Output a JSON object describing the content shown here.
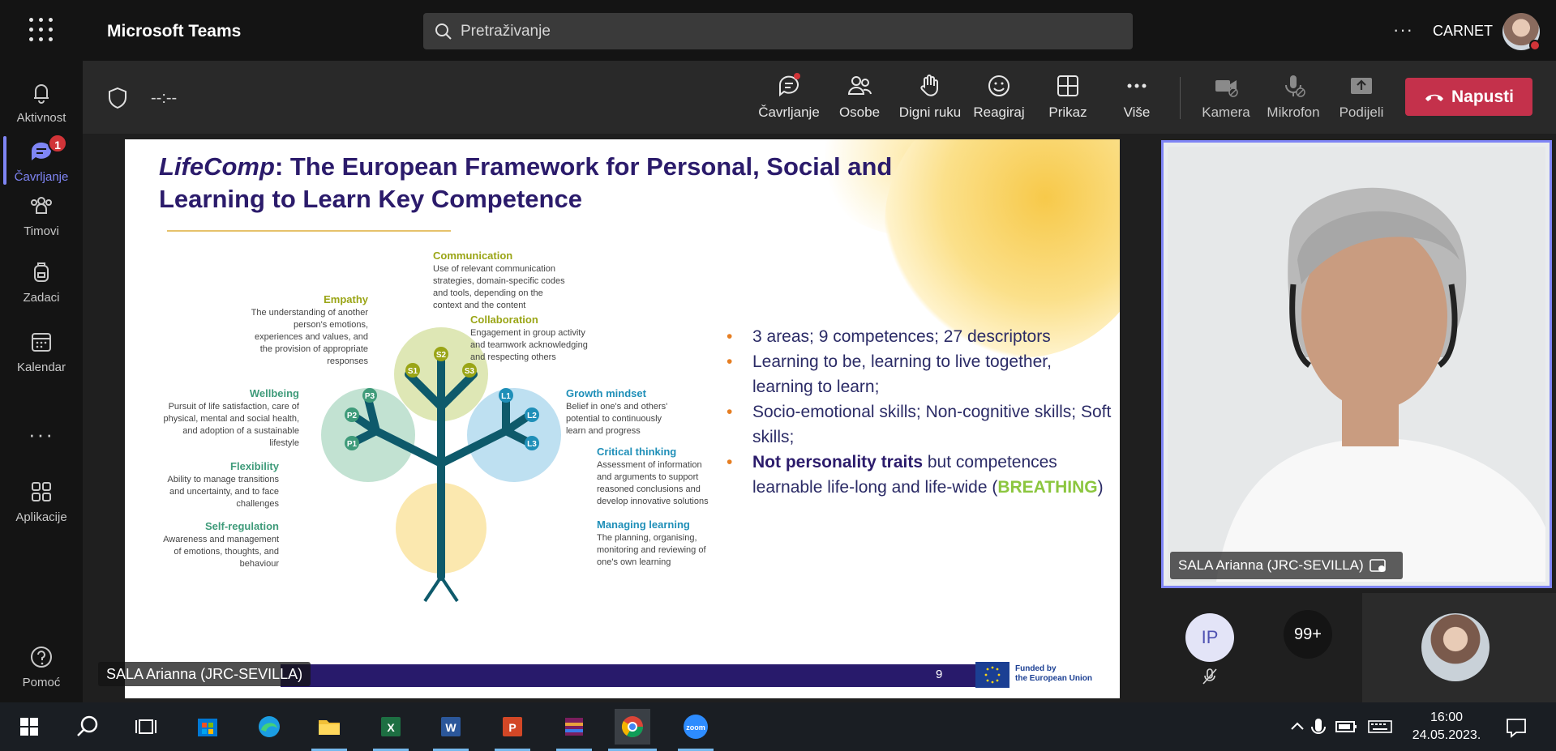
{
  "app": {
    "title": "Microsoft Teams",
    "org": "CARNET"
  },
  "search": {
    "placeholder": "Pretraživanje"
  },
  "rail": {
    "items": [
      {
        "label": "Aktivnost",
        "icon": "bell-icon"
      },
      {
        "label": "Čavrljanje",
        "icon": "chat-icon",
        "badge": "1",
        "active": true
      },
      {
        "label": "Timovi",
        "icon": "teams-icon"
      },
      {
        "label": "Zadaci",
        "icon": "backpack-icon"
      },
      {
        "label": "Kalendar",
        "icon": "calendar-icon"
      },
      {
        "label": "Aplikacije",
        "icon": "apps-icon"
      },
      {
        "label": "Pomoć",
        "icon": "help-icon"
      }
    ],
    "more": "···"
  },
  "meeting": {
    "timer": "--:--",
    "buttons": [
      {
        "label": "Čavrljanje",
        "icon": "chat-icon"
      },
      {
        "label": "Osobe",
        "icon": "people-icon"
      },
      {
        "label": "Digni ruku",
        "icon": "hand-icon"
      },
      {
        "label": "Reagiraj",
        "icon": "smile-icon"
      },
      {
        "label": "Prikaz",
        "icon": "layout-icon"
      },
      {
        "label": "Više",
        "icon": "more-icon"
      },
      {
        "label": "Kamera",
        "icon": "camera-off-icon"
      },
      {
        "label": "Mikrofon",
        "icon": "mic-off-icon"
      },
      {
        "label": "Podijeli",
        "icon": "share-icon"
      }
    ],
    "leave": "Napusti",
    "more_dots": "···"
  },
  "slide": {
    "title_italic": "LifeComp",
    "title_rest": ": The European Framework for Personal, Social and Learning to Learn Key Competence",
    "competences": {
      "communication": {
        "head": "Communication",
        "body": "Use of relevant communication strategies, domain-specific codes and tools, depending on the context and the content"
      },
      "empathy": {
        "head": "Empathy",
        "body": "The understanding of another person's emotions, experiences and values, and the provision of appropriate responses"
      },
      "collaboration": {
        "head": "Collaboration",
        "body": "Engagement in group activity and teamwork acknowledging and respecting others"
      },
      "wellbeing": {
        "head": "Wellbeing",
        "body": "Pursuit of life satisfaction, care of physical, mental and social health, and adoption of a sustainable lifestyle"
      },
      "growth": {
        "head": "Growth mindset",
        "body": "Belief in one's and others' potential to continuously learn and progress"
      },
      "flexibility": {
        "head": "Flexibility",
        "body": "Ability to manage transitions and uncertainty, and to face challenges"
      },
      "critical": {
        "head": "Critical thinking",
        "body": "Assessment of information and arguments to support reasoned conclusions and develop innovative solutions"
      },
      "selfreg": {
        "head": "Self-regulation",
        "body": "Awareness and management of emotions, thoughts, and behaviour"
      },
      "managing": {
        "head": "Managing learning",
        "body": "The planning, organising, monitoring and reviewing of one's own learning"
      }
    },
    "nodes": {
      "s1": "S1",
      "s2": "S2",
      "s3": "S3",
      "p1": "P1",
      "p2": "P2",
      "p3": "P3",
      "l1": "L1",
      "l2": "L2",
      "l3": "L3"
    },
    "bullets": {
      "b1": "3 areas; 9 competences; 27 descriptors",
      "b2": "Learning to be, learning to live together, learning to learn;",
      "b3": "Socio-emotional skills; Non-cognitive skills; Soft skills;",
      "b4_bold": "Not personality traits",
      "b4_rest": " but competences learnable life-long and life-wide (",
      "b4_green": "BREATHING",
      "b4_end": ")"
    },
    "page_number": "9",
    "eu_line1": "Funded by",
    "eu_line2": "the European Union",
    "accent": "#281a6b"
  },
  "presenter_name": "SALA Arianna (JRC-SEVILLA)",
  "video": {
    "name": "SALA Arianna (JRC-SEVILLA)"
  },
  "participants": {
    "initials": "IP",
    "overflow": "99+"
  },
  "taskbar": {
    "time": "16:00",
    "date": "24.05.2023."
  }
}
